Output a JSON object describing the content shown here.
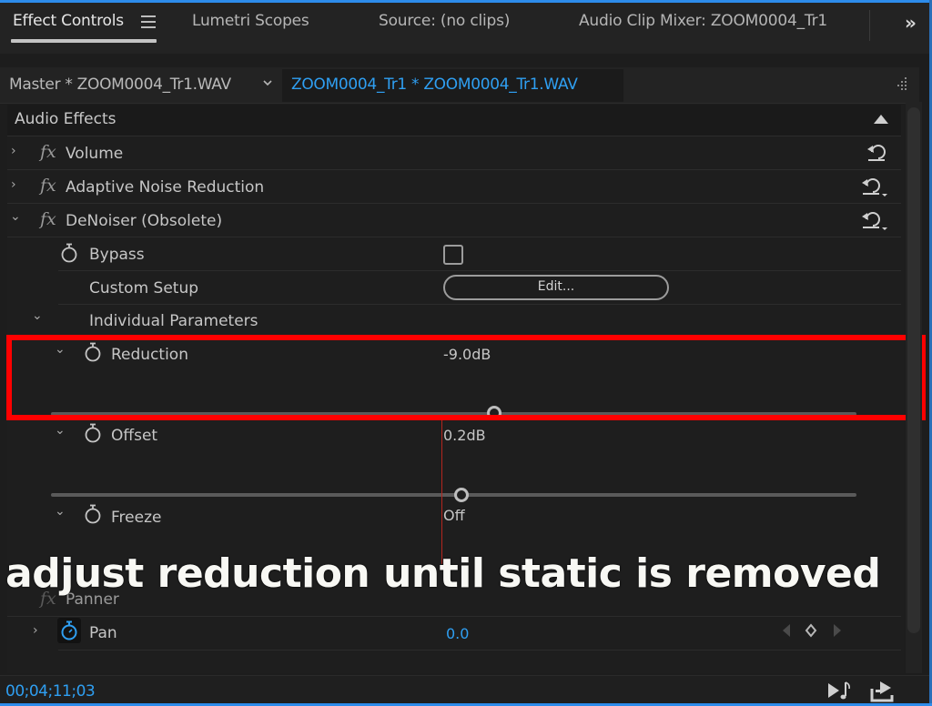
{
  "tabs": [
    {
      "label": "Effect Controls",
      "active": true
    },
    {
      "label": "Lumetri Scopes",
      "active": false
    },
    {
      "label": "Source: (no clips)",
      "active": false
    },
    {
      "label": "Audio Clip Mixer: ZOOM0004_Tr1",
      "active": false
    }
  ],
  "tab_overflow": "»",
  "clip_header": {
    "master": "Master * ZOOM0004_Tr1.WAV",
    "active_clip": "ZOOM0004_Tr1 * ZOOM0004_Tr1.WAV"
  },
  "section": {
    "title": "Audio Effects"
  },
  "effects": [
    {
      "name": "Volume",
      "expanded": false
    },
    {
      "name": "Adaptive Noise Reduction",
      "expanded": false
    },
    {
      "name": "DeNoiser (Obsolete)",
      "expanded": true
    }
  ],
  "denoiser": {
    "bypass": {
      "label": "Bypass",
      "checked": false
    },
    "custom_setup": {
      "label": "Custom Setup",
      "button": "Edit..."
    },
    "individual_parameters": {
      "label": "Individual Parameters"
    },
    "reduction": {
      "label": "Reduction",
      "value": "-9.0dB",
      "slider_fraction": 0.55
    },
    "offset": {
      "label": "Offset",
      "value": "0.2dB",
      "slider_fraction": 0.51
    },
    "freeze": {
      "label": "Freeze",
      "value": "Off"
    }
  },
  "panner": {
    "name": "Panner",
    "pan": {
      "label": "Pan",
      "value": "0.0"
    }
  },
  "caption": "adjust reduction until static is removed",
  "footer": {
    "timecode": "00;04;11;03"
  },
  "colors": {
    "accent_blue": "#2f9ff2",
    "highlight_red": "#ff0000",
    "playhead_red": "#b3261e",
    "background": "#1e1e1e"
  }
}
